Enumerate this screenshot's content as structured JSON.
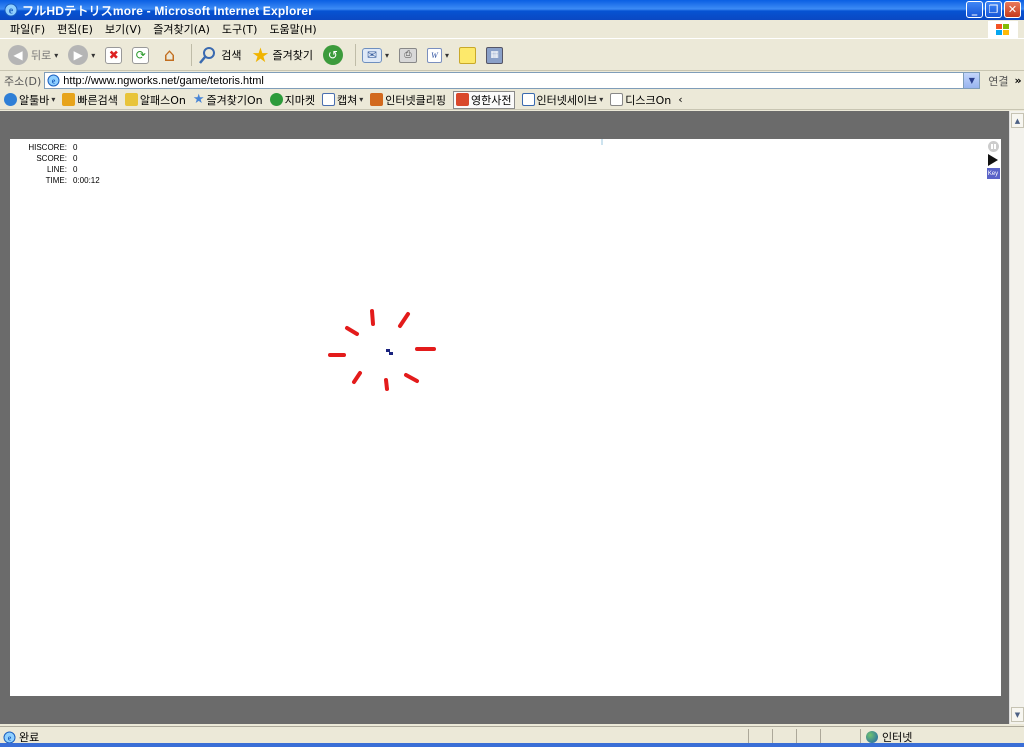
{
  "window": {
    "title": "フルHDテトリスmore - Microsoft Internet Explorer",
    "minimize": "_",
    "restore": "❐",
    "close": "✕"
  },
  "menu": [
    "파일(F)",
    "편집(E)",
    "보기(V)",
    "즐겨찾기(A)",
    "도구(T)",
    "도움말(H)"
  ],
  "toolbar": {
    "back": "뒤로",
    "search": "검색",
    "favorites": "즐겨찾기"
  },
  "address": {
    "label": "주소(D)",
    "url": "http://www.ngworks.net/game/tetoris.html",
    "go": "연결",
    "more": "»"
  },
  "links": {
    "alttoolbar": "알툴바",
    "quick_search": "빠른검색",
    "alpass": "알패스On",
    "favorites_on": "즐겨찾기On",
    "gmarket": "지마켓",
    "capture": "캡쳐",
    "clipping": "인터넷클리핑",
    "dictionary": "영한사전",
    "internet_save": "인터넷세이브",
    "disk_on": "디스크On",
    "more": "‹"
  },
  "game": {
    "stats": [
      {
        "label": "HISCORE:",
        "value": "0"
      },
      {
        "label": "SCORE:",
        "value": "0"
      },
      {
        "label": "LINE:",
        "value": "0"
      },
      {
        "label": "TIME:",
        "value": "0:00:12"
      }
    ],
    "key_label": "Key"
  },
  "status": {
    "text": "완료",
    "zone": "인터넷"
  },
  "colors": {
    "spinner": "#e31b1b",
    "center_mark": "#1a237e",
    "title_bar": "#0a5fe3"
  }
}
